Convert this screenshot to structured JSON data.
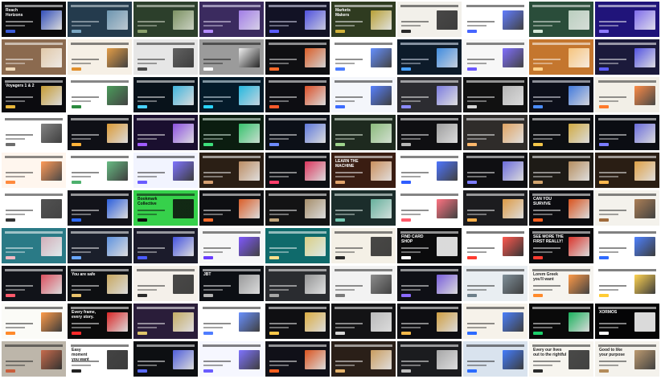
{
  "gallery": {
    "tiles": [
      {
        "bg": "#0b0b0d",
        "fg": "#ffffff",
        "accent": "#3a5bd9",
        "label": "Reach\nHorizons"
      },
      {
        "bg": "#243b4d",
        "fg": "#d7e1e8",
        "accent": "#7aa6c2",
        "label": ""
      },
      {
        "bg": "#2c3f2b",
        "fg": "#e5eadc",
        "accent": "#8aa06c",
        "label": ""
      },
      {
        "bg": "#3b2b5f",
        "fg": "#f1ecff",
        "accent": "#b48cff",
        "label": ""
      },
      {
        "bg": "#121225",
        "fg": "#e7e8ff",
        "accent": "#5a5cff",
        "label": ""
      },
      {
        "bg": "#2f3b20",
        "fg": "#ffffff",
        "accent": "#d1b23a",
        "label": "Markets\nMakers"
      },
      {
        "bg": "#f2f0ea",
        "fg": "#1e1e1e",
        "accent": "#2a2a2a",
        "label": ""
      },
      {
        "bg": "#ffffff",
        "fg": "#202020",
        "accent": "#4666ff",
        "label": ""
      },
      {
        "bg": "#2a4d3a",
        "fg": "#f4f7f3",
        "accent": "#d4e6d7",
        "label": ""
      },
      {
        "bg": "#20147a",
        "fg": "#ffffff",
        "accent": "#8f7bff",
        "label": ""
      },
      {
        "bg": "#8b6a4f",
        "fg": "#ffffff",
        "accent": "#f0d9b8",
        "label": ""
      },
      {
        "bg": "#f6f0e6",
        "fg": "#222222",
        "accent": "#e18f2b",
        "label": ""
      },
      {
        "bg": "#e6e6e6",
        "fg": "#202020",
        "accent": "#4a4a4a",
        "label": ""
      },
      {
        "bg": "#9b9b9b",
        "fg": "#111111",
        "accent": "#ffffff",
        "label": ""
      },
      {
        "bg": "#0f0f12",
        "fg": "#f4f4f4",
        "accent": "#ff6b2b",
        "label": ""
      },
      {
        "bg": "#ffffff",
        "fg": "#222222",
        "accent": "#4a7cff",
        "label": ""
      },
      {
        "bg": "#0d1b2a",
        "fg": "#e7f0ff",
        "accent": "#48a0ff",
        "label": ""
      },
      {
        "bg": "#f7f7f7",
        "fg": "#222222",
        "accent": "#6b57ff",
        "label": ""
      },
      {
        "bg": "#c4762e",
        "fg": "#ffffff",
        "accent": "#ffd28b",
        "label": ""
      },
      {
        "bg": "#1b1a3b",
        "fg": "#ffffff",
        "accent": "#5c5cff",
        "label": ""
      },
      {
        "bg": "#0b0b0f",
        "fg": "#ffffff",
        "accent": "#e8b63a",
        "label": "Voyagers 1 & 2"
      },
      {
        "bg": "#ffffff",
        "fg": "#222222",
        "accent": "#2b8a3e",
        "label": ""
      },
      {
        "bg": "#08121a",
        "fg": "#ffffff",
        "accent": "#49d1ff",
        "label": ""
      },
      {
        "bg": "#041b2a",
        "fg": "#e6f5ff",
        "accent": "#2ad4ff",
        "label": ""
      },
      {
        "bg": "#0d0d12",
        "fg": "#ffffff",
        "accent": "#ff5a2b",
        "label": ""
      },
      {
        "bg": "#f4f6fb",
        "fg": "#1d1d1d",
        "accent": "#3c6cff",
        "label": ""
      },
      {
        "bg": "#2c2c31",
        "fg": "#ffffff",
        "accent": "#8b8bff",
        "label": ""
      },
      {
        "bg": "#111111",
        "fg": "#ffffff",
        "accent": "#d2d2d2",
        "label": ""
      },
      {
        "bg": "#0c0f1a",
        "fg": "#f5f7ff",
        "accent": "#4b8dff",
        "label": ""
      },
      {
        "bg": "#f2efe7",
        "fg": "#2a2a2a",
        "accent": "#ff7a2b",
        "label": ""
      },
      {
        "bg": "#ffffff",
        "fg": "#1c1c1c",
        "accent": "#6d6d6d",
        "label": ""
      },
      {
        "bg": "#0f1016",
        "fg": "#ffffff",
        "accent": "#ffb23a",
        "label": ""
      },
      {
        "bg": "#1a0f2f",
        "fg": "#ffffff",
        "accent": "#a15cff",
        "label": ""
      },
      {
        "bg": "#0b1d10",
        "fg": "#e9fff1",
        "accent": "#3ee07c",
        "label": ""
      },
      {
        "bg": "#0c1018",
        "fg": "#ffffff",
        "accent": "#6d8bff",
        "label": ""
      },
      {
        "bg": "#1e2a1f",
        "fg": "#f2fff0",
        "accent": "#9fd48d",
        "label": ""
      },
      {
        "bg": "#0f0f12",
        "fg": "#ffffff",
        "accent": "#b7b7b7",
        "label": ""
      },
      {
        "bg": "#2f2c2a",
        "fg": "#ffffff",
        "accent": "#ffb86b",
        "label": ""
      },
      {
        "bg": "#0d0f12",
        "fg": "#ffffff",
        "accent": "#f3c64a",
        "label": ""
      },
      {
        "bg": "#0b0d13",
        "fg": "#ffffff",
        "accent": "#7a7cff",
        "label": ""
      },
      {
        "bg": "#fff6ee",
        "fg": "#2a2a2a",
        "accent": "#ff8a3d",
        "label": ""
      },
      {
        "bg": "#ffffff",
        "fg": "#1c1c1c",
        "accent": "#4db06d",
        "label": ""
      },
      {
        "bg": "#f2f4ff",
        "fg": "#1c1c1c",
        "accent": "#6a5cff",
        "label": ""
      },
      {
        "bg": "#2b1f15",
        "fg": "#ffffff",
        "accent": "#d5a071",
        "label": ""
      },
      {
        "bg": "#0d0f13",
        "fg": "#ffffff",
        "accent": "#ff3d6b",
        "label": ""
      },
      {
        "bg": "#3a1d12",
        "fg": "#ffffff",
        "accent": "#e3a46b",
        "label": "LEARN THE\nMACHINE"
      },
      {
        "bg": "#ffffff",
        "fg": "#1f1f1f",
        "accent": "#2f5dff",
        "label": ""
      },
      {
        "bg": "#0f0f12",
        "fg": "#ffffff",
        "accent": "#7c7cff",
        "label": ""
      },
      {
        "bg": "#1e1b16",
        "fg": "#ffffff",
        "accent": "#d1a36c",
        "label": ""
      },
      {
        "bg": "#2a1e14",
        "fg": "#ffffff",
        "accent": "#ffb84f",
        "label": ""
      },
      {
        "bg": "#ffffff",
        "fg": "#222222",
        "accent": "#333333",
        "label": ""
      },
      {
        "bg": "#12131a",
        "fg": "#ffffff",
        "accent": "#2f6bff",
        "label": ""
      },
      {
        "bg": "#36d14b",
        "fg": "#0b0b0b",
        "accent": "#0b0b0b",
        "label": "Bookmark\nCollective"
      },
      {
        "bg": "#0e0f12",
        "fg": "#ffffff",
        "accent": "#ff6b2b",
        "label": ""
      },
      {
        "bg": "#131314",
        "fg": "#ffffff",
        "accent": "#c0a47a",
        "label": ""
      },
      {
        "bg": "#1b2d2b",
        "fg": "#f2fffb",
        "accent": "#73c7b0",
        "label": ""
      },
      {
        "bg": "#ffffff",
        "fg": "#1f1f1f",
        "accent": "#ff5a6b",
        "label": ""
      },
      {
        "bg": "#1c1c1f",
        "fg": "#ffffff",
        "accent": "#ffb04a",
        "label": ""
      },
      {
        "bg": "#0c0c10",
        "fg": "#ffffff",
        "accent": "#ff5f1f",
        "label": "CAN YOU\nSURVIVE"
      },
      {
        "bg": "#f4f2ec",
        "fg": "#222222",
        "accent": "#a06b3c",
        "label": ""
      },
      {
        "bg": "#2a7a86",
        "fg": "#ffffff",
        "accent": "#f0b7c1",
        "label": ""
      },
      {
        "bg": "#1a1f2b",
        "fg": "#ffffff",
        "accent": "#6aa7ff",
        "label": ""
      },
      {
        "bg": "#1b1b2b",
        "fg": "#ffffff",
        "accent": "#4b5cff",
        "label": ""
      },
      {
        "bg": "#f6f6f7",
        "fg": "#222222",
        "accent": "#6a3cff",
        "label": ""
      },
      {
        "bg": "#0f6a6b",
        "fg": "#ffffff",
        "accent": "#ffe08a",
        "label": ""
      },
      {
        "bg": "#f4f0e6",
        "fg": "#222222",
        "accent": "#2a2a2a",
        "label": ""
      },
      {
        "bg": "#0b0b0c",
        "fg": "#ffffff",
        "accent": "#ffffff",
        "label": "FIND CARD\nSHOP"
      },
      {
        "bg": "#ffffff",
        "fg": "#111111",
        "accent": "#ff3b30",
        "label": ""
      },
      {
        "bg": "#0b0b0d",
        "fg": "#ffffff",
        "accent": "#ff3b30",
        "label": "SEE MORE THE\nFIRST REALLY!"
      },
      {
        "bg": "#ffffff",
        "fg": "#1a1a1a",
        "accent": "#2f6bff",
        "label": ""
      },
      {
        "bg": "#111319",
        "fg": "#ffffff",
        "accent": "#ff5a6b",
        "label": ""
      },
      {
        "bg": "#0d0f12",
        "fg": "#ffffff",
        "accent": "#e9c36d",
        "label": "You are safe"
      },
      {
        "bg": "#f4f0ea",
        "fg": "#222222",
        "accent": "#2b2b2b",
        "label": ""
      },
      {
        "bg": "#0c0f14",
        "fg": "#ffffff",
        "accent": "#b2b2b2",
        "label": "JBT"
      },
      {
        "bg": "#2a2c30",
        "fg": "#ffffff",
        "accent": "#a7a7a7",
        "label": ""
      },
      {
        "bg": "#f2f2f2",
        "fg": "#222222",
        "accent": "#7a7a7a",
        "label": ""
      },
      {
        "bg": "#0f1016",
        "fg": "#ffffff",
        "accent": "#8b6bff",
        "label": ""
      },
      {
        "bg": "#e9eef2",
        "fg": "#1f1f1f",
        "accent": "#6d7f8a",
        "label": ""
      },
      {
        "bg": "#f6f4ef",
        "fg": "#222222",
        "accent": "#ff8a2b",
        "label": "Lorem Greek\nyou'll want"
      },
      {
        "bg": "#ffffff",
        "fg": "#1a1a1a",
        "accent": "#ffcc33",
        "label": ""
      },
      {
        "bg": "#fbfbf7",
        "fg": "#1a1a1a",
        "accent": "#ff8a2b",
        "label": ""
      },
      {
        "bg": "#0b0b0b",
        "fg": "#ffffff",
        "accent": "#ff2b2b",
        "label": "Every frame,\nevery story."
      },
      {
        "bg": "#2a1d3a",
        "fg": "#ffffff",
        "accent": "#e0c66b",
        "label": ""
      },
      {
        "bg": "#ffffff",
        "fg": "#1d1d1d",
        "accent": "#4f7dff",
        "label": ""
      },
      {
        "bg": "#0f0f12",
        "fg": "#ffffff",
        "accent": "#ffc84a",
        "label": ""
      },
      {
        "bg": "#131315",
        "fg": "#ffffff",
        "accent": "#d7d7d7",
        "label": ""
      },
      {
        "bg": "#0e0e12",
        "fg": "#ffffff",
        "accent": "#f2b84a",
        "label": ""
      },
      {
        "bg": "#f6f2ea",
        "fg": "#1f1f1f",
        "accent": "#2d6bff",
        "label": ""
      },
      {
        "bg": "#0a0a0a",
        "fg": "#ffffff",
        "accent": "#1ccf6b",
        "label": ""
      },
      {
        "bg": "#050506",
        "fg": "#ffffff",
        "accent": "#ffffff",
        "label": "XORMOS"
      },
      {
        "bg": "#bdb6aa",
        "fg": "#1b1b1b",
        "accent": "#c95e3c",
        "label": ""
      },
      {
        "bg": "#ffffff",
        "fg": "#1a1a1a",
        "accent": "#222222",
        "label": "Easy\nmoment\nyou want"
      },
      {
        "bg": "#0d0f12",
        "fg": "#ffffff",
        "accent": "#5a6bff",
        "label": ""
      },
      {
        "bg": "#f6f7ff",
        "fg": "#1d1d1d",
        "accent": "#6a5cff",
        "label": ""
      },
      {
        "bg": "#101018",
        "fg": "#ffffff",
        "accent": "#ff5f1f",
        "label": ""
      },
      {
        "bg": "#2a1f18",
        "fg": "#ffffff",
        "accent": "#e6b36b",
        "label": ""
      },
      {
        "bg": "#1b1c1f",
        "fg": "#ffffff",
        "accent": "#bfbfbf",
        "label": ""
      },
      {
        "bg": "#d9e3ee",
        "fg": "#1e1e1e",
        "accent": "#2b6bff",
        "label": ""
      },
      {
        "bg": "#f7f5ef",
        "fg": "#222222",
        "accent": "#2b2b2b",
        "label": "Every our lives\nout to the rightful"
      },
      {
        "bg": "#f4f2ec",
        "fg": "#222222",
        "accent": "#b38b5a",
        "label": "Good to like\nyour purpose"
      }
    ]
  }
}
